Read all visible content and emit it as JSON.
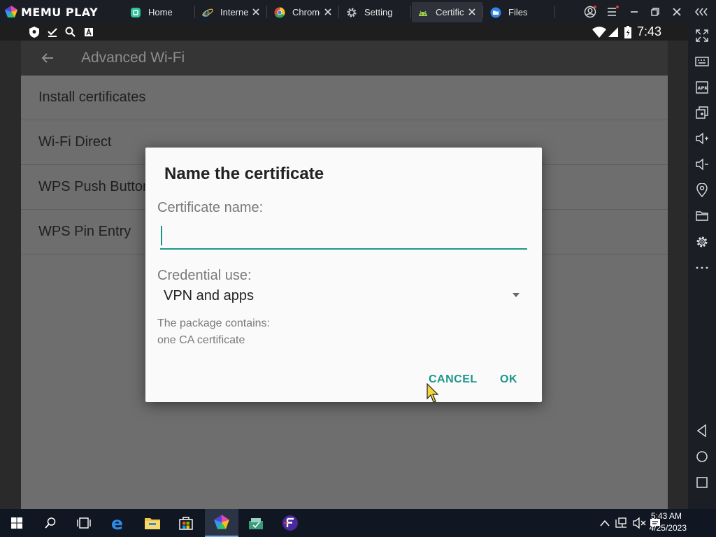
{
  "titlebar": {
    "app_name": "MEMU PLAY",
    "tabs": [
      {
        "label": "Home",
        "icon": "home-app-icon",
        "active": false
      },
      {
        "label": "Interne",
        "icon": "ie-icon",
        "active": false
      },
      {
        "label": "Chrome",
        "icon": "chrome-icon",
        "active": false
      },
      {
        "label": "Setting",
        "icon": "settings-gear-icon",
        "active": false
      },
      {
        "label": "Certific",
        "icon": "android-icon",
        "active": true
      },
      {
        "label": "Files",
        "icon": "files-icon",
        "active": false
      }
    ]
  },
  "statusbar": {
    "time": "7:43"
  },
  "appbar": {
    "title": "Advanced Wi-Fi"
  },
  "settings_list": {
    "items": [
      {
        "label": "Install certificates"
      },
      {
        "label": "Wi-Fi Direct"
      },
      {
        "label": "WPS Push Button"
      },
      {
        "label": "WPS Pin Entry"
      }
    ]
  },
  "dialog": {
    "title": "Name the certificate",
    "cert_name_label": "Certificate name:",
    "cert_name_value": "",
    "credential_use_label": "Credential use:",
    "credential_use_value": "VPN and apps",
    "package_line1": "The package contains:",
    "package_line2": "one CA certificate",
    "cancel_label": "CANCEL",
    "ok_label": "OK"
  },
  "colors": {
    "accent": "#1c968a",
    "dialog_bg": "#fafafa",
    "dimmed_list": "#6e6e6e"
  },
  "taskbar": {
    "time": "5:43 AM",
    "date": "4/25/2023"
  }
}
